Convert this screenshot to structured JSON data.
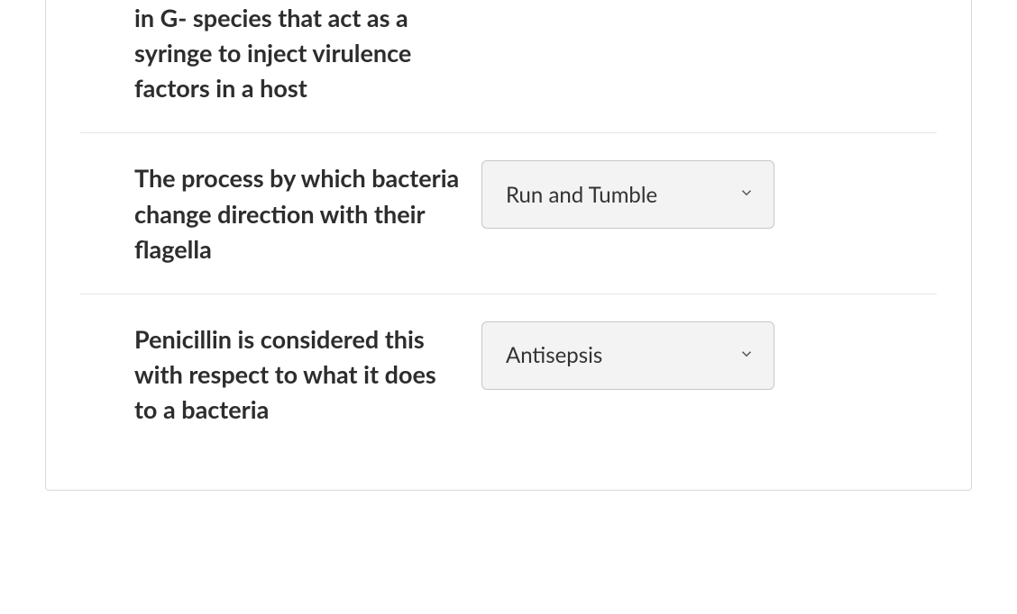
{
  "questions": [
    {
      "prompt_fragment": "in G- species that act as a syringe to inject virulence factors in a host",
      "selected": ""
    },
    {
      "prompt": "The process by which bacteria change direction with their flagella",
      "selected": "Run and Tumble"
    },
    {
      "prompt": "Penicillin is considered this with respect to what it does to a bacteria",
      "selected": "Antisepsis"
    }
  ]
}
